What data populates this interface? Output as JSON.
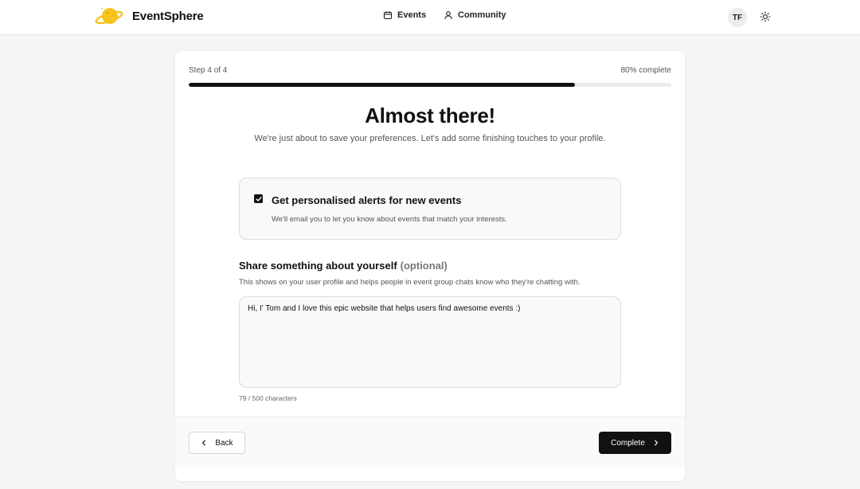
{
  "header": {
    "brand": "EventSphere",
    "nav": [
      {
        "label": "Events",
        "icon": "calendar-icon"
      },
      {
        "label": "Community",
        "icon": "user-icon"
      }
    ],
    "avatar_initials": "TF",
    "theme_icon": "sun-icon"
  },
  "progress": {
    "step_label": "Step 4 of 4",
    "percent_label": "80% complete",
    "fraction": 0.8
  },
  "main": {
    "title": "Almost there!",
    "subtitle": "We're just about to save your preferences. Let's add some finishing touches to your profile."
  },
  "alerts": {
    "checked": true,
    "title": "Get personalised alerts for new events",
    "description": "We'll email you to let you know about events that match your interests."
  },
  "bio": {
    "label": "Share something about yourself",
    "optional": "(optional)",
    "help": "This shows on your user profile and helps people in event group chats know who they're chatting with.",
    "value": "Hi, I' Tom and I love this epic website that helps users find awesome events :)",
    "char_count": "79 / 500 characters"
  },
  "footer": {
    "back_label": "Back",
    "complete_label": "Complete"
  },
  "colors": {
    "accent": "#111111",
    "logo": "#f5c518"
  }
}
